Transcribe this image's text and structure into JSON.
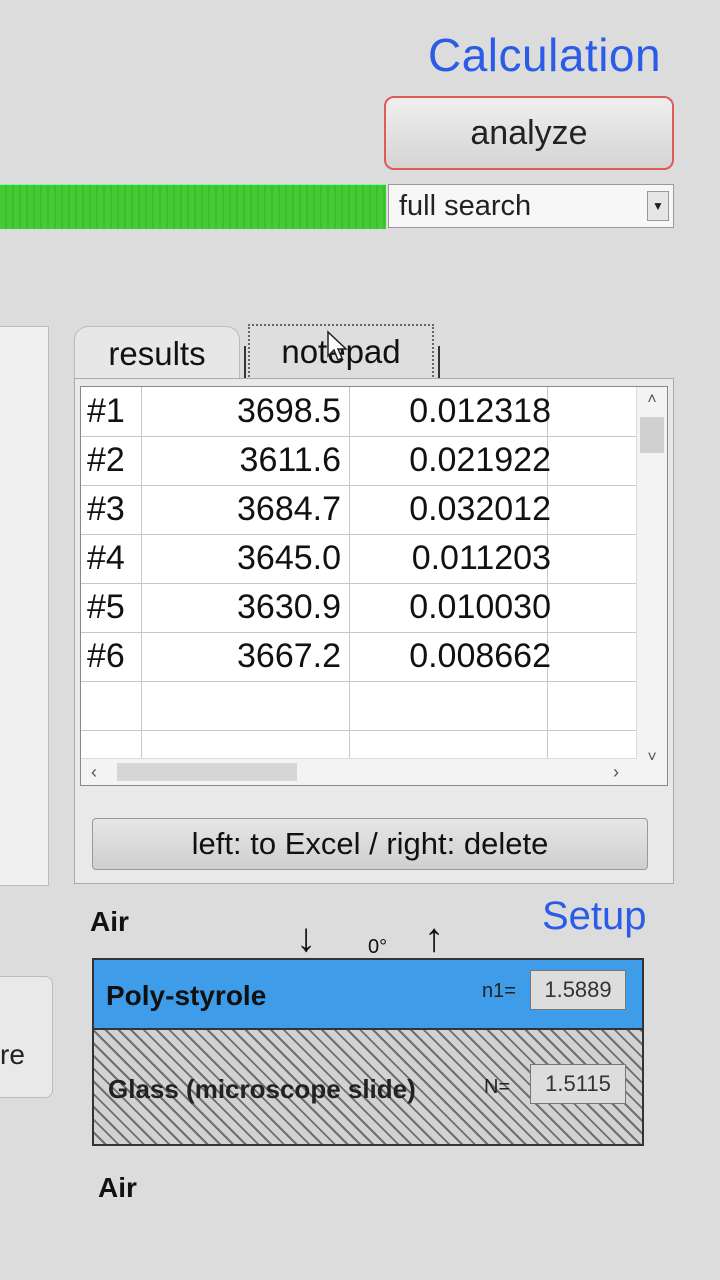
{
  "header": {
    "title": "Calculation",
    "analyze_label": "analyze",
    "search_mode": "full search"
  },
  "left_partial_label": "re",
  "tabs": [
    {
      "label": "results",
      "active": true
    },
    {
      "label": "notepad",
      "active": false
    }
  ],
  "results": {
    "rows": [
      {
        "id": "#1",
        "value": "3698.5",
        "error": "0.012318"
      },
      {
        "id": "#2",
        "value": "3611.6",
        "error": "0.021922"
      },
      {
        "id": "#3",
        "value": "3684.7",
        "error": "0.032012"
      },
      {
        "id": "#4",
        "value": "3645.0",
        "error": "0.011203"
      },
      {
        "id": "#5",
        "value": "3630.9",
        "error": "0.010030"
      },
      {
        "id": "#6",
        "value": "3667.2",
        "error": "0.008662"
      }
    ],
    "export_label": "left: to Excel / right: delete"
  },
  "setup": {
    "title": "Setup",
    "top_medium": "Air",
    "angle": "0°",
    "layers": [
      {
        "name": "Poly-styrole",
        "n_label": "n1=",
        "n_value": "1.5889",
        "color": "#3f9ce8"
      },
      {
        "name": "Glass (microscope slide)",
        "n_label": "N=",
        "n_value": "1.5115"
      }
    ],
    "bottom_medium": "Air"
  },
  "colors": {
    "accent_title": "#2b5ce8",
    "progress": "#44cc33",
    "analyze_border": "#e05a5a"
  }
}
